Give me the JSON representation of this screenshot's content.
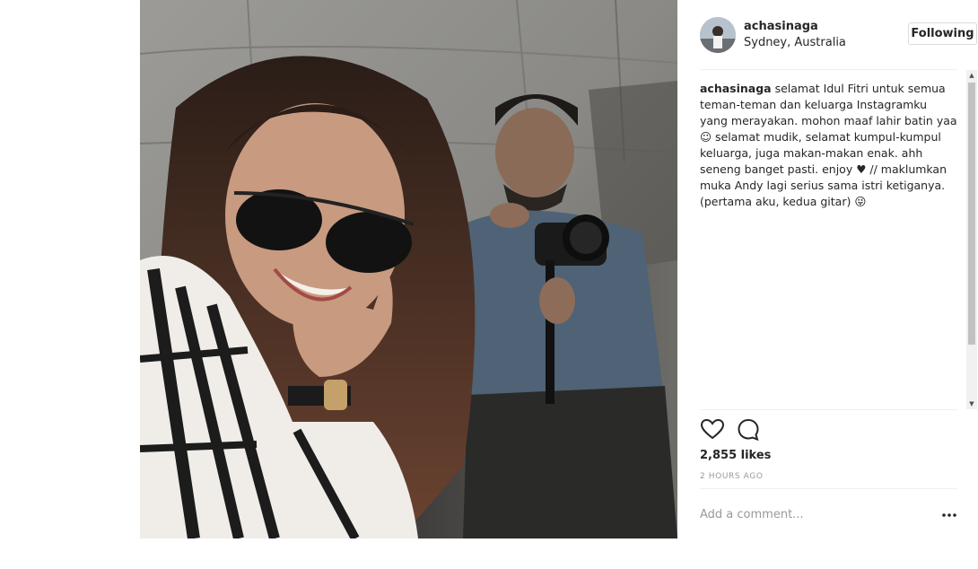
{
  "post": {
    "username": "achasinaga",
    "location": "Sydney, Australia",
    "follow_label": "Following",
    "caption_user": "achasinaga",
    "caption_text": " selamat Idul Fitri untuk semua teman-teman dan keluarga Instagramku yang merayakan. mohon maaf lahir batin yaa ☺ selamat mudik, selamat kumpul-kumpul keluarga, juga makan-makan enak. ahh seneng banget pasti. enjoy ♥ // maklumkan muka Andy lagi serius sama istri ketiganya. (pertama aku, kedua gitar) 😜",
    "likes": "2,855 likes",
    "time": "2 HOURS AGO",
    "comment_placeholder": "Add a comment..."
  },
  "icons": {
    "like": "heart-icon",
    "comment": "speech-bubble-icon",
    "more": "more-options-icon",
    "scroll_up": "scroll-up-arrow",
    "scroll_down": "scroll-down-arrow"
  },
  "colors": {
    "text": "#262626",
    "muted": "#999999",
    "border": "#efefef"
  }
}
